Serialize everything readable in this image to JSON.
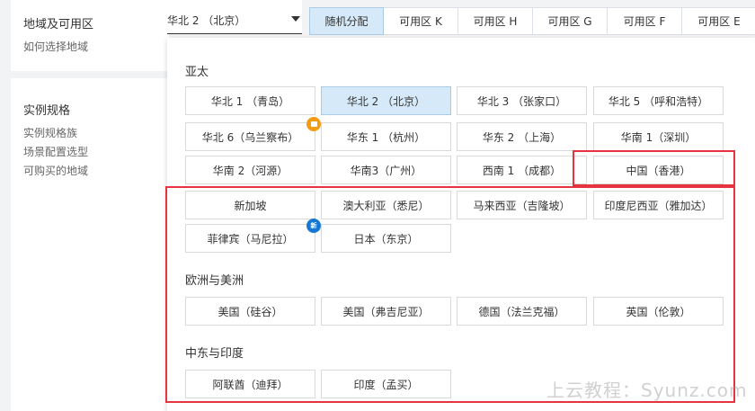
{
  "left": {
    "region_title": "地域及可用区",
    "region_link": "如何选择地域",
    "spec_title": "实例规格",
    "spec_links": [
      "实例规格族",
      "场景配置选型",
      "可购买的地域"
    ]
  },
  "region_select": {
    "value": "华北 2 （北京）"
  },
  "zone_tabs": [
    "随机分配",
    "可用区 K",
    "可用区 H",
    "可用区 G",
    "可用区 F",
    "可用区 E"
  ],
  "dropdown": {
    "groups": [
      {
        "title": "亚太"
      },
      {
        "title": "欧洲与美洲"
      },
      {
        "title": "中东与印度"
      }
    ],
    "asia": [
      "华北 1 （青岛）",
      "华北 2 （北京）",
      "华北 3 （张家口）",
      "华北 5 （呼和浩特）",
      "华北 6（乌兰察布）",
      "华东 1 （杭州）",
      "华东 2 （上海）",
      "华南 1（深圳）",
      "华南 2（河源）",
      "华南3（广州）",
      "西南 1 （成都）",
      "中国（香港）",
      "新加坡",
      "澳大利亚（悉尼）",
      "马来西亚（吉隆坡）",
      "印度尼西亚（雅加达）",
      "菲律宾（马尼拉）",
      "日本（东京）"
    ],
    "europe_america": [
      "美国（硅谷）",
      "美国（弗吉尼亚）",
      "德国（法兰克福）",
      "英国（伦敦）"
    ],
    "middle_east_india": [
      "阿联酋（迪拜）",
      "印度（孟买）"
    ],
    "new_badge": "新"
  },
  "watermark": "上云教程：Syunz.com",
  "colors": {
    "accent": "#d6e9f8",
    "highlight": "#e5343d"
  }
}
